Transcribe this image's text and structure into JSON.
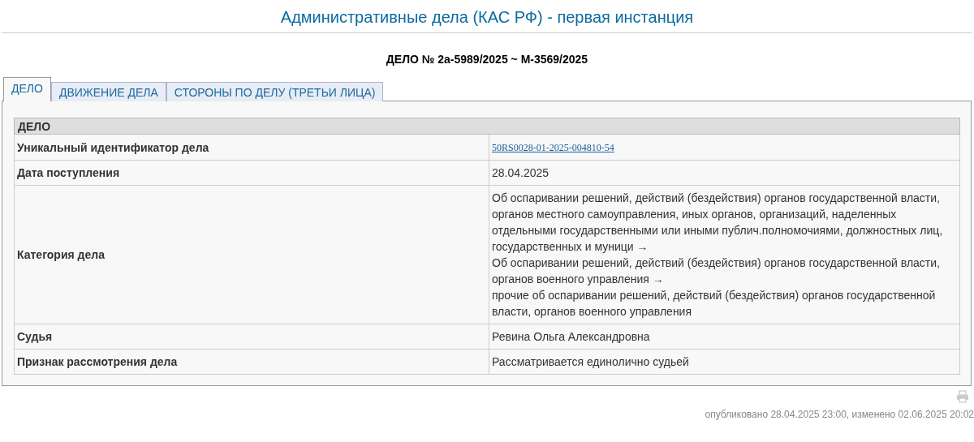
{
  "page_title": "Административные дела (КАС РФ) - первая инстанция",
  "case_title": "ДЕЛО № 2а-5989/2025 ~ М-3569/2025",
  "tabs": [
    {
      "label": "ДЕЛО",
      "selected": true
    },
    {
      "label": "ДВИЖЕНИЕ ДЕЛА",
      "selected": false
    },
    {
      "label": "СТОРОНЫ ПО ДЕЛУ (ТРЕТЬИ ЛИЦА)",
      "selected": false
    }
  ],
  "table": {
    "heading": "ДЕЛО",
    "rows": [
      {
        "label": "Уникальный идентификатор дела",
        "kind": "link",
        "value": "50RS0028-01-2025-004810-54"
      },
      {
        "label": "Дата поступления",
        "kind": "text",
        "value": "28.04.2025"
      },
      {
        "label": "Категория дела",
        "kind": "lines",
        "lines": [
          "Об оспаривании решений, действий (бездействия) органов государственной власти, органов местного самоуправления, иных органов, организаций, наделенных отдельными государственными или иными публич.полномочиями, должностных лиц, государственных и муници →",
          "Об оспаривании решений, действий (бездействия) органов государственной власти, органов военного управления →",
          "прочие об оспаривании решений, действий (бездействия) органов государственной власти, органов военного управления"
        ]
      },
      {
        "label": "Судья",
        "kind": "text",
        "value": "Ревина Ольга Александровна"
      },
      {
        "label": "Признак рассмотрения дела",
        "kind": "text",
        "value": "Рассматривается единолично судьей"
      }
    ]
  },
  "footer": "опубликовано 28.04.2025 23:00, изменено 02.06.2025 20:02"
}
